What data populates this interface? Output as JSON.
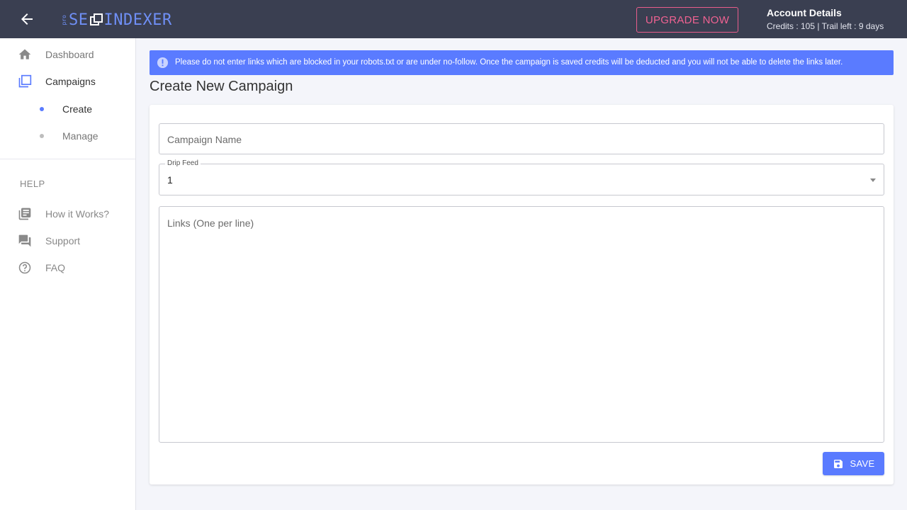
{
  "header": {
    "logo_pro": "pro",
    "logo_left": "SE",
    "logo_right": "INDEXER",
    "upgrade_label": "UPGRADE NOW",
    "account_title": "Account Details",
    "account_sub": "Credits : 105 | Trail left : 9 days"
  },
  "sidebar": {
    "items": [
      {
        "label": "Dashboard",
        "icon": "home-icon"
      },
      {
        "label": "Campaigns",
        "icon": "campaigns-icon"
      },
      {
        "label": "Create",
        "icon": "dot"
      },
      {
        "label": "Manage",
        "icon": "dot"
      }
    ],
    "help_heading": "HELP",
    "help_items": [
      {
        "label": "How it Works?",
        "icon": "library-books-icon"
      },
      {
        "label": "Support",
        "icon": "forum-icon"
      },
      {
        "label": "FAQ",
        "icon": "help-circle-icon"
      }
    ]
  },
  "main": {
    "alert_text": "Please do not enter links which are blocked in your robots.txt or are under no-follow. Once the campaign is saved credits will be deducted and you will not be able to delete the links later.",
    "page_title": "Create New Campaign",
    "form": {
      "campaign_name_placeholder": "Campaign Name",
      "drip_feed_label": "Drip Feed",
      "drip_feed_value": "1",
      "links_placeholder": "Links (One per line)",
      "save_label": "SAVE"
    }
  },
  "colors": {
    "topbar": "#3a3f51",
    "accent": "#5a7bff",
    "upgrade": "#f06292"
  }
}
